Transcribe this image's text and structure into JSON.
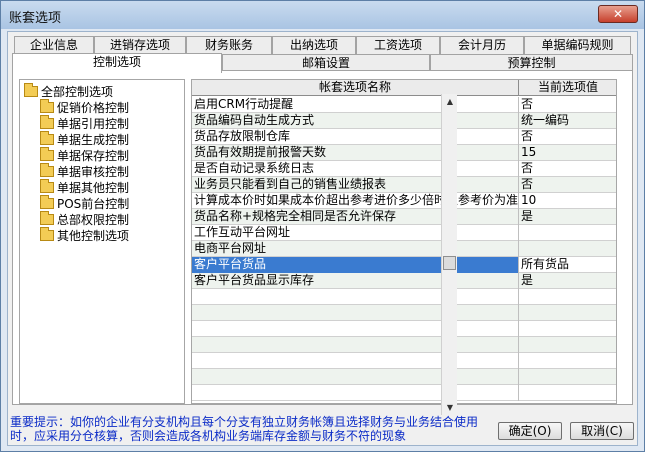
{
  "window": {
    "title": "账套选项",
    "close_glyph": "✕"
  },
  "tabs_row1": [
    "企业信息",
    "进销存选项",
    "财务账务",
    "出纳选项",
    "工资选项",
    "会计月历",
    "单据编码规则"
  ],
  "tabs_row2": [
    "控制选项",
    "邮箱设置",
    "预算控制"
  ],
  "active_tab": "控制选项",
  "tree": {
    "root": "全部控制选项",
    "items": [
      "促销价格控制",
      "单据引用控制",
      "单据生成控制",
      "单据保存控制",
      "单据审核控制",
      "单据其他控制",
      "POS前台控制",
      "总部权限控制",
      "其他控制选项"
    ]
  },
  "grid": {
    "headers": [
      "帐套选项名称",
      "当前选项值"
    ],
    "rows": [
      {
        "name": "启用CRM行动提醒",
        "value": "否"
      },
      {
        "name": "货品编码自动生成方式",
        "value": "统一编码"
      },
      {
        "name": "货品存放限制仓库",
        "value": "否"
      },
      {
        "name": "货品有效期提前报警天数",
        "value": "15"
      },
      {
        "name": "是否自动记录系统日志",
        "value": "否"
      },
      {
        "name": "业务员只能看到自己的销售业绩报表",
        "value": "否"
      },
      {
        "name": "计算成本价时如果成本价超出参考进价多少倍时以参考价为准",
        "value": "10"
      },
      {
        "name": "货品名称+规格完全相同是否允许保存",
        "value": "是"
      },
      {
        "name": "工作互动平台网址",
        "value": ""
      },
      {
        "name": "电商平台网址",
        "value": ""
      },
      {
        "name": "客户平台货品",
        "value": "所有货品"
      },
      {
        "name": "客户平台货品显示库存",
        "value": "是"
      },
      {
        "name": "",
        "value": ""
      },
      {
        "name": "",
        "value": ""
      },
      {
        "name": "",
        "value": ""
      },
      {
        "name": "",
        "value": ""
      },
      {
        "name": "",
        "value": ""
      },
      {
        "name": "",
        "value": ""
      },
      {
        "name": "",
        "value": ""
      }
    ],
    "selected_row": 10
  },
  "notice": "重要提示：如你的企业有分支机构且每个分支有独立财务帐簿且选择财务与业务结合使用时，应采用分仓核算，否则会造成各机构业务端库存金额与财务不符的现象",
  "buttons": {
    "ok": "确定(O)",
    "cancel": "取消(C)"
  },
  "colors": {
    "notice": "#0b2bc7",
    "selection": "#3a7bd0",
    "alt_row": "#eef3ee"
  }
}
